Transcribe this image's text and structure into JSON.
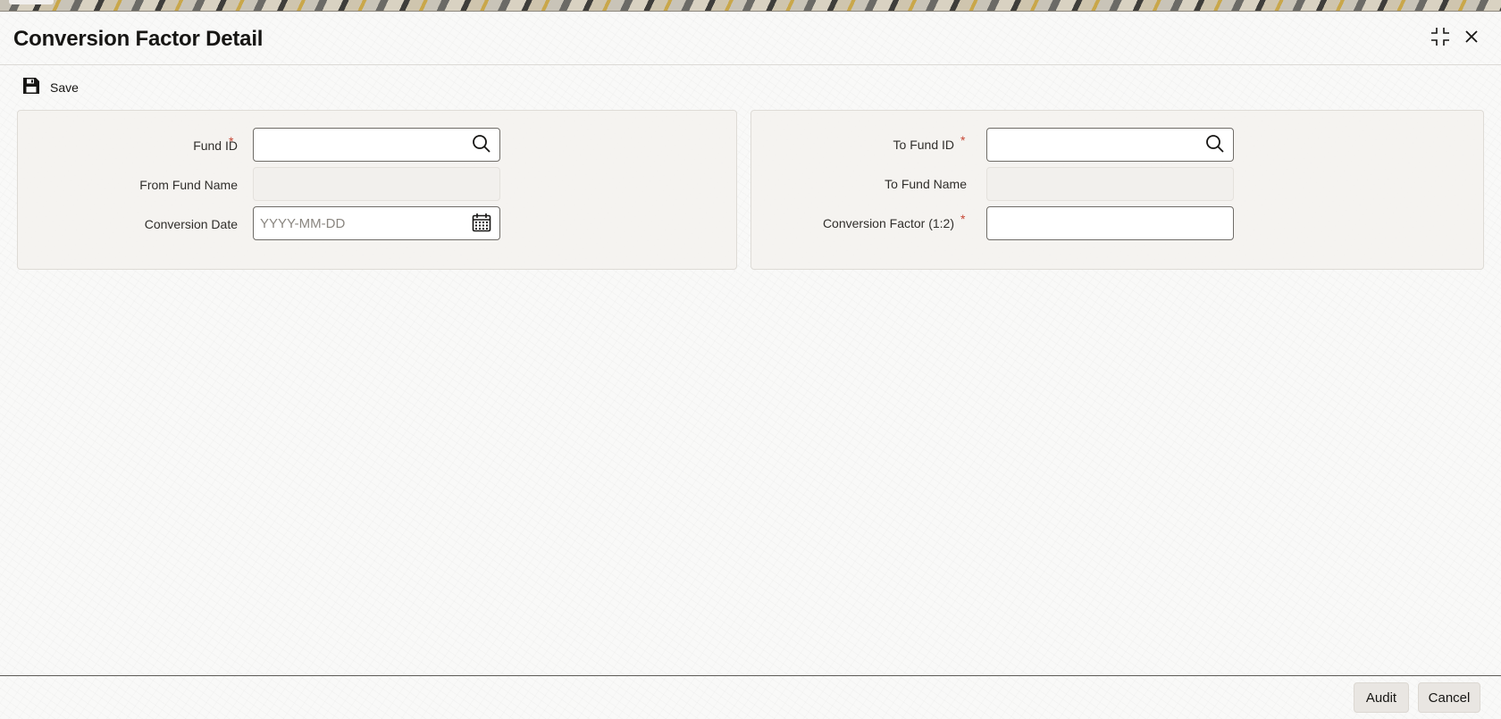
{
  "window": {
    "title": "Conversion Factor Detail"
  },
  "toolbar": {
    "save_label": "Save"
  },
  "left_panel": {
    "fund_id": {
      "label": "Fund ID",
      "required": "*",
      "value": ""
    },
    "from_fund_name": {
      "label": "From Fund Name",
      "value": ""
    },
    "conversion_date": {
      "label": "Conversion Date",
      "placeholder": "YYYY-MM-DD",
      "value": ""
    }
  },
  "right_panel": {
    "to_fund_id": {
      "label": "To Fund ID",
      "required": "*",
      "value": ""
    },
    "to_fund_name": {
      "label": "To Fund Name",
      "value": ""
    },
    "conversion_factor": {
      "label": "Conversion Factor (1:2)",
      "required": "*",
      "value": ""
    }
  },
  "footer": {
    "audit_label": "Audit",
    "cancel_label": "Cancel"
  },
  "colors": {
    "required_marker": "#c74634",
    "text": "#161513",
    "button_bg": "#e9e6e2"
  },
  "icons": {
    "save": "save-icon",
    "maximize": "maximize-icon",
    "close": "close-icon",
    "search": "search-icon",
    "calendar": "calendar-icon"
  }
}
